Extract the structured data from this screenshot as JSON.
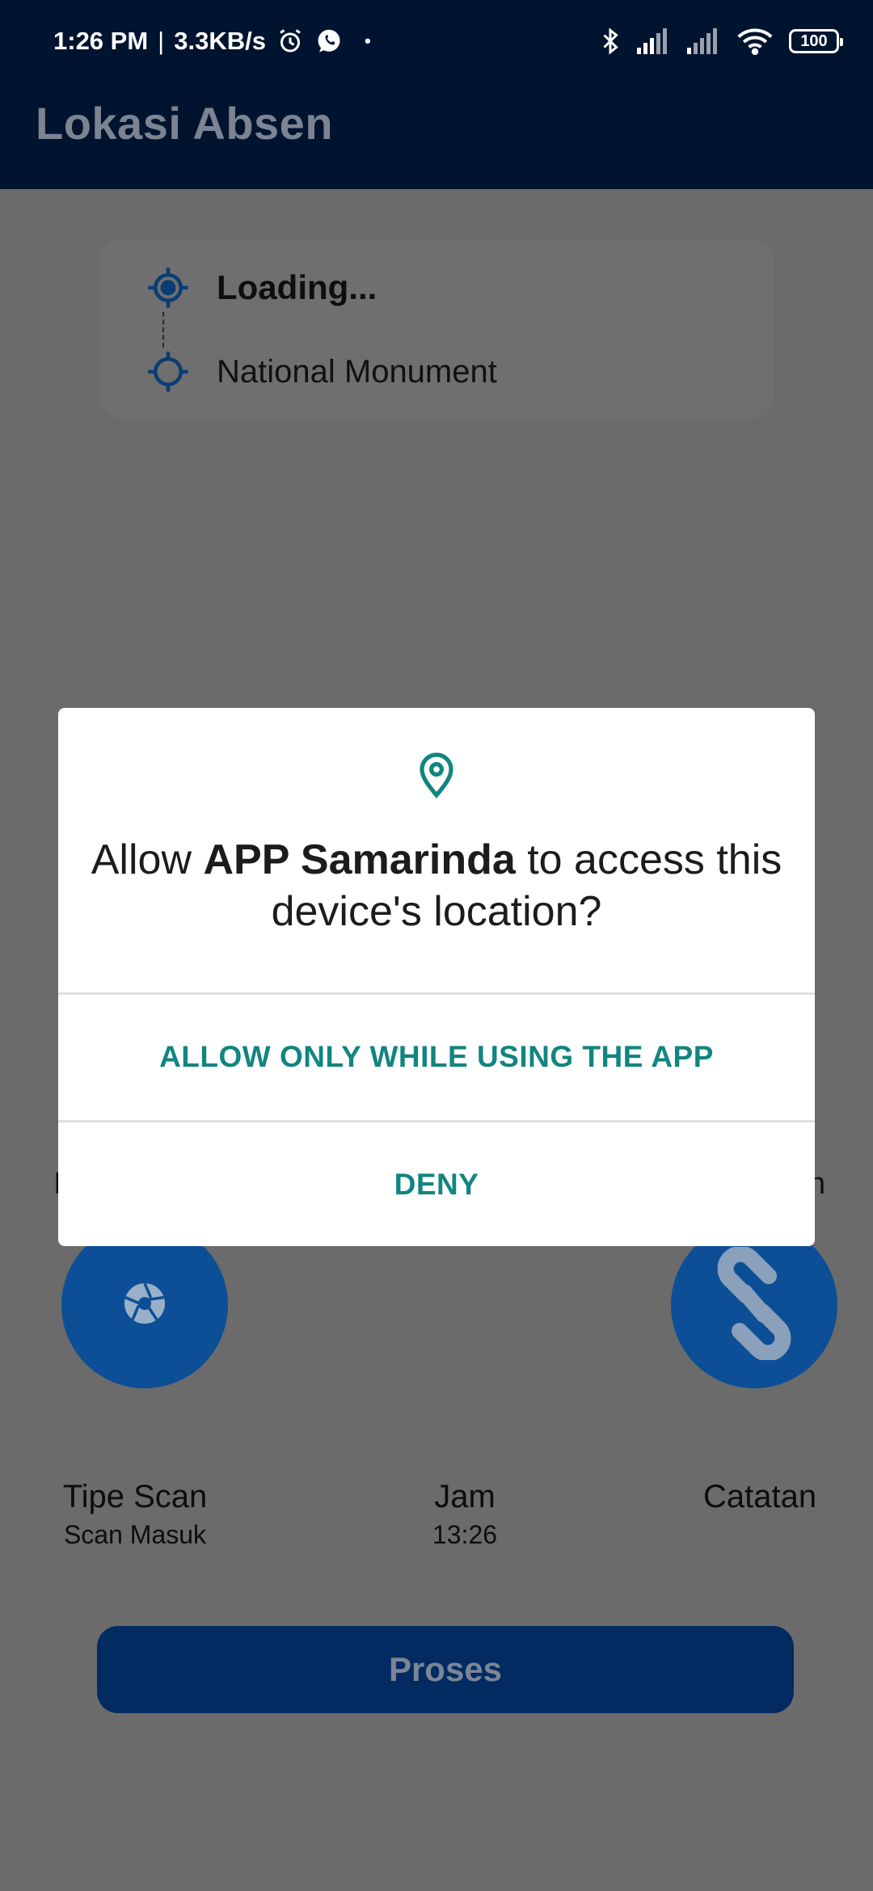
{
  "status_bar": {
    "time": "1:26 PM",
    "separator": "|",
    "net_speed": "3.3KB/s",
    "dot": "•",
    "battery": "100",
    "icons": [
      "alarm-icon",
      "whatsapp-icon",
      "bluetooth-icon",
      "signal-icon",
      "signal-icon",
      "wifi-icon",
      "battery-icon"
    ]
  },
  "app_bar": {
    "title": "Lokasi Absen"
  },
  "location_card": {
    "origin": "Loading...",
    "destination": "National Monument"
  },
  "peek": {
    "left_char": "I",
    "right_text": "n"
  },
  "actions": {
    "left_icon": "camera-shutter-icon",
    "right_icon": "link-icon"
  },
  "info": {
    "tipe_label": "Tipe Scan",
    "tipe_value": "Scan Masuk",
    "jam_label": "Jam",
    "jam_value": "13:26",
    "catatan_label": "Catatan"
  },
  "proses_button": {
    "label": "Proses"
  },
  "permission_dialog": {
    "msg_prefix": "Allow ",
    "app_name": "APP Samarinda",
    "msg_suffix": " to access this device's location?",
    "allow_label": "ALLOW ONLY WHILE USING THE APP",
    "deny_label": "DENY"
  },
  "colors": {
    "scrim": "#6b6b6b",
    "top_bar": "#00142f",
    "primary_circle": "#0c4f96",
    "proses_button": "#022b62",
    "dialog_accent": "#128580"
  }
}
